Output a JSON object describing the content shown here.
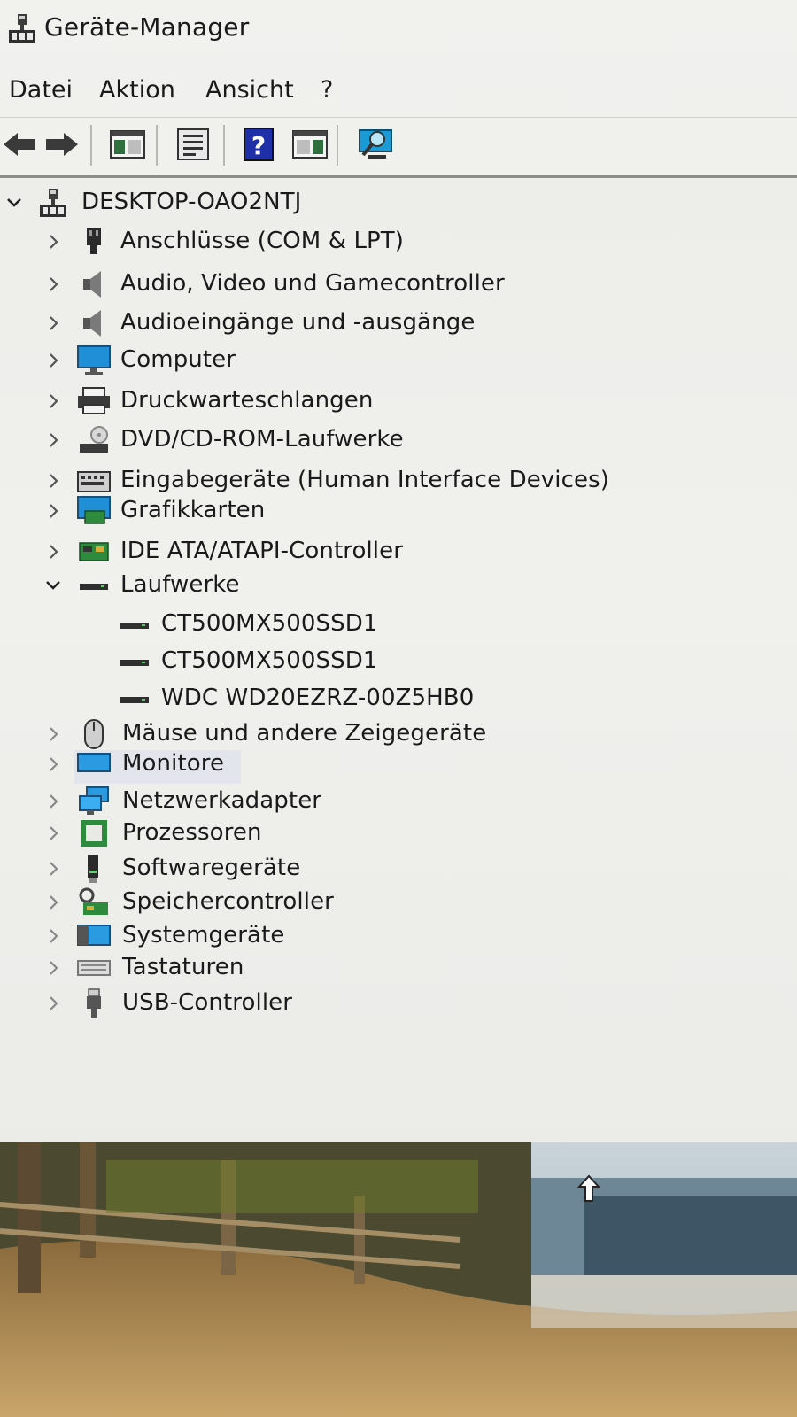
{
  "window": {
    "title": "Geräte-Manager",
    "title_icon": "device-manager-icon"
  },
  "menu": {
    "items": [
      "Datei",
      "Aktion",
      "Ansicht",
      "?"
    ]
  },
  "toolbar": {
    "buttons": [
      {
        "name": "back-arrow-icon"
      },
      {
        "name": "forward-arrow-icon"
      },
      {
        "name": "show-hide-console-tree-icon"
      },
      {
        "name": "properties-icon"
      },
      {
        "name": "help-icon"
      },
      {
        "name": "action-pane-icon"
      },
      {
        "name": "scan-hardware-icon"
      }
    ]
  },
  "tree": {
    "root": {
      "label": "DESKTOP-OAO2NTJ",
      "expanded": true,
      "icon": "computer-network-icon"
    },
    "categories": [
      {
        "label": "Anschlüsse (COM & LPT)",
        "icon": "port-icon",
        "expanded": false
      },
      {
        "label": "Audio, Video und Gamecontroller",
        "icon": "speaker-icon",
        "expanded": false
      },
      {
        "label": "Audioeingänge und -ausgänge",
        "icon": "speaker-icon",
        "expanded": false
      },
      {
        "label": "Computer",
        "icon": "monitor-icon",
        "expanded": false
      },
      {
        "label": "Druckwarteschlangen",
        "icon": "printer-icon",
        "expanded": false
      },
      {
        "label": "DVD/CD-ROM-Laufwerke",
        "icon": "disc-drive-icon",
        "expanded": false
      },
      {
        "label": "Eingabegeräte (Human Interface Devices)",
        "icon": "hid-icon",
        "expanded": false
      },
      {
        "label": "Grafikkarten",
        "icon": "display-adapter-icon",
        "expanded": false
      },
      {
        "label": "IDE ATA/ATAPI-Controller",
        "icon": "ide-controller-icon",
        "expanded": false
      },
      {
        "label": "Laufwerke",
        "icon": "drive-icon",
        "expanded": true,
        "children": [
          "CT500MX500SSD1",
          "CT500MX500SSD1",
          "WDC WD20EZRZ-00Z5HB0"
        ]
      },
      {
        "label": "Mäuse und andere Zeigegeräte",
        "icon": "mouse-icon",
        "expanded": false
      },
      {
        "label": "Monitore",
        "icon": "monitor-icon",
        "expanded": false
      },
      {
        "label": "Netzwerkadapter",
        "icon": "network-adapter-icon",
        "expanded": false
      },
      {
        "label": "Prozessoren",
        "icon": "processor-icon",
        "expanded": false
      },
      {
        "label": "Softwaregeräte",
        "icon": "software-device-icon",
        "expanded": false
      },
      {
        "label": "Speichercontroller",
        "icon": "storage-controller-icon",
        "expanded": false
      },
      {
        "label": "Systemgeräte",
        "icon": "system-devices-icon",
        "expanded": false
      },
      {
        "label": "Tastaturen",
        "icon": "keyboard-icon",
        "expanded": false
      },
      {
        "label": "USB-Controller",
        "icon": "usb-icon",
        "expanded": false
      }
    ]
  },
  "colors": {
    "window_bg": "#ececea",
    "selection": "#e2e6ec",
    "text": "#1a1a1a"
  }
}
